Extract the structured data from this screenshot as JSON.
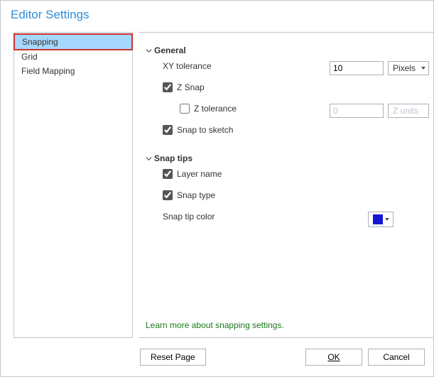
{
  "title": "Editor Settings",
  "sidebar": {
    "items": [
      {
        "label": "Snapping",
        "active": true
      },
      {
        "label": "Grid",
        "active": false
      },
      {
        "label": "Field Mapping",
        "active": false
      }
    ]
  },
  "sections": {
    "general": {
      "label": "General",
      "xy_tolerance_label": "XY tolerance",
      "xy_tolerance_value": "10",
      "xy_tolerance_units": "Pixels",
      "z_snap_label": "Z Snap",
      "z_snap_checked": true,
      "z_tolerance_label": "Z tolerance",
      "z_tolerance_checked": false,
      "z_tolerance_value": "0",
      "z_tolerance_units": "Z units",
      "snap_to_sketch_label": "Snap to sketch",
      "snap_to_sketch_checked": true
    },
    "snap_tips": {
      "label": "Snap tips",
      "layer_name_label": "Layer name",
      "layer_name_checked": true,
      "snap_type_label": "Snap type",
      "snap_type_checked": true,
      "snap_tip_color_label": "Snap tip color",
      "snap_tip_color": "#1414d6"
    }
  },
  "learn_more": "Learn more about snapping settings.",
  "footer": {
    "reset": "Reset Page",
    "ok": "OK",
    "cancel": "Cancel"
  }
}
